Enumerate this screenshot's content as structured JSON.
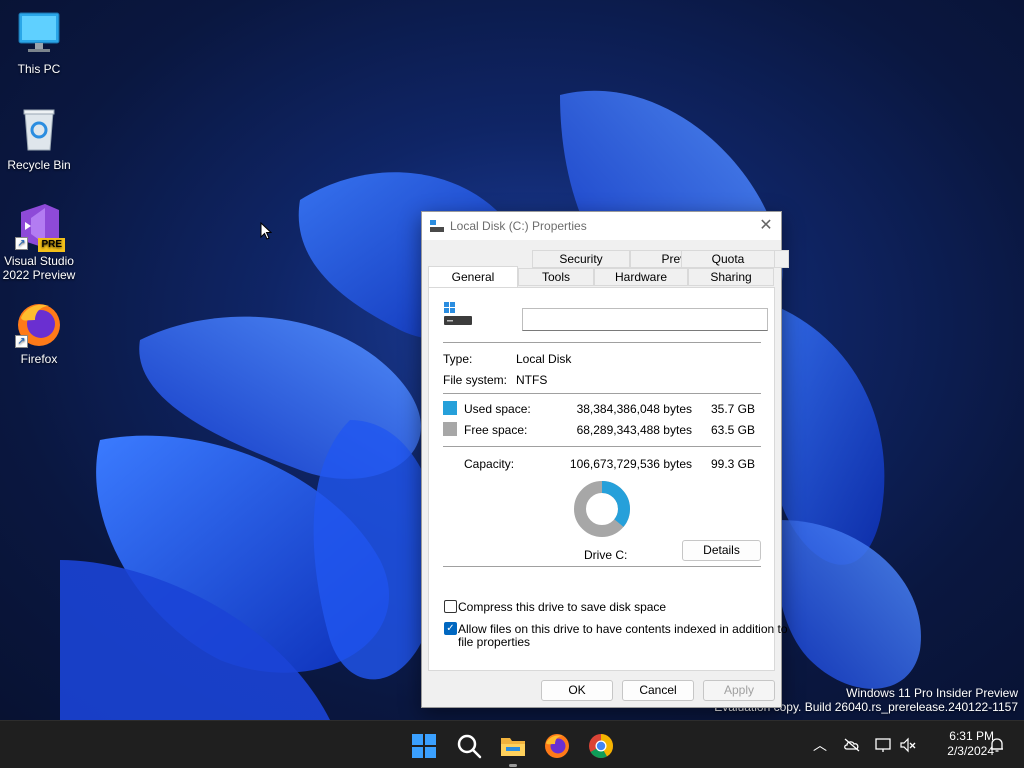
{
  "desktop": {
    "icons": [
      {
        "label": "This PC",
        "icon": "monitor-icon"
      },
      {
        "label": "Recycle Bin",
        "icon": "recycle-bin-icon"
      },
      {
        "label": "Visual Studio\n2022 Preview",
        "icon": "visual-studio-icon",
        "badge": "PRE"
      },
      {
        "label": "Firefox",
        "icon": "firefox-icon"
      }
    ],
    "watermark_line1": "Windows 11 Pro Insider Preview",
    "watermark_line2": "Evaluation copy. Build 26040.rs_prerelease.240122-1157"
  },
  "dialog": {
    "title": "Local Disk (C:) Properties",
    "tabs_top": [
      "Security",
      "Previous Versions",
      "Quota"
    ],
    "tabs_bottom": [
      "General",
      "Tools",
      "Hardware",
      "Sharing"
    ],
    "active_tab": "General",
    "name_value": "",
    "type_label": "Type:",
    "type_value": "Local Disk",
    "fs_label": "File system:",
    "fs_value": "NTFS",
    "used_label": "Used space:",
    "used_bytes": "38,384,386,048 bytes",
    "used_gb": "35.7 GB",
    "free_label": "Free space:",
    "free_bytes": "68,289,343,488 bytes",
    "free_gb": "63.5 GB",
    "capacity_label": "Capacity:",
    "capacity_bytes": "106,673,729,536 bytes",
    "capacity_gb": "99.3 GB",
    "used_fraction": 0.36,
    "used_color": "#26a0da",
    "free_color": "#a7a7a7",
    "drive_label": "Drive C:",
    "details_label": "Details",
    "compress_label": "Compress this drive to save disk space",
    "compress_checked": false,
    "index_label_1": "Allow files on this drive to have contents indexed in addition to",
    "index_label_2": "file properties",
    "index_checked": true,
    "ok_label": "OK",
    "cancel_label": "Cancel",
    "apply_label": "Apply"
  },
  "taskbar": {
    "time": "6:31 PM",
    "date": "2/3/2024"
  }
}
